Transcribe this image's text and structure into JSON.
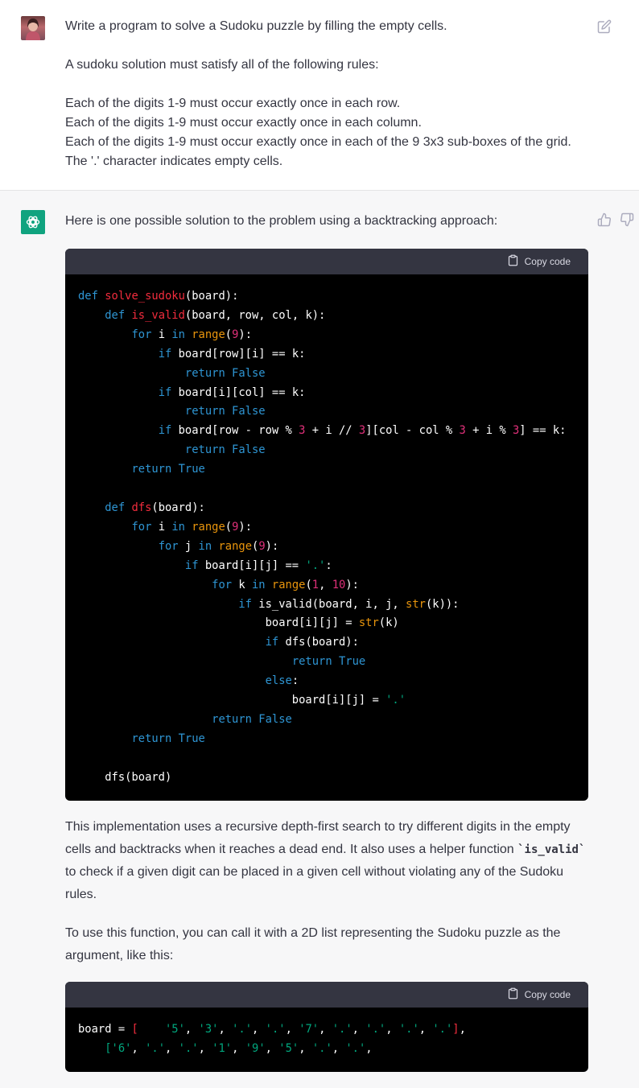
{
  "user": {
    "avatar": "user-avatar",
    "lines": [
      "Write a program to solve a Sudoku puzzle by filling the empty cells.",
      "A sudoku solution must satisfy all of the following rules:",
      "Each of the digits 1-9 must occur exactly once in each row.",
      "Each of the digits 1-9 must occur exactly once in each column.",
      "Each of the digits 1-9 must occur exactly once in each of the 9 3x3 sub-boxes of the grid.",
      "The '.' character indicates empty cells."
    ]
  },
  "assistant": {
    "intro": "Here is one possible solution to the problem using a backtracking approach:",
    "copy_label": "Copy code",
    "code1": [
      [
        [
          "kw",
          "def "
        ],
        [
          "fn",
          "solve_sudoku"
        ],
        [
          "nm",
          "(board):"
        ]
      ],
      [
        [
          "nm",
          "    "
        ],
        [
          "kw",
          "def "
        ],
        [
          "fn",
          "is_valid"
        ],
        [
          "nm",
          "(board, row, col, k):"
        ]
      ],
      [
        [
          "nm",
          "        "
        ],
        [
          "kw",
          "for "
        ],
        [
          "nm",
          "i "
        ],
        [
          "kw",
          "in "
        ],
        [
          "bi",
          "range"
        ],
        [
          "nm",
          "("
        ],
        [
          "num",
          "9"
        ],
        [
          "nm",
          "):"
        ]
      ],
      [
        [
          "nm",
          "            "
        ],
        [
          "kw",
          "if "
        ],
        [
          "nm",
          "board[row][i] == k:"
        ]
      ],
      [
        [
          "nm",
          "                "
        ],
        [
          "kw",
          "return False"
        ]
      ],
      [
        [
          "nm",
          "            "
        ],
        [
          "kw",
          "if "
        ],
        [
          "nm",
          "board[i][col] == k:"
        ]
      ],
      [
        [
          "nm",
          "                "
        ],
        [
          "kw",
          "return False"
        ]
      ],
      [
        [
          "nm",
          "            "
        ],
        [
          "kw",
          "if "
        ],
        [
          "nm",
          "board[row - row % "
        ],
        [
          "num",
          "3"
        ],
        [
          "nm",
          " + i // "
        ],
        [
          "num",
          "3"
        ],
        [
          "nm",
          "][col - col % "
        ],
        [
          "num",
          "3"
        ],
        [
          "nm",
          " + i % "
        ],
        [
          "num",
          "3"
        ],
        [
          "nm",
          "] == k:"
        ]
      ],
      [
        [
          "nm",
          "                "
        ],
        [
          "kw",
          "return False"
        ]
      ],
      [
        [
          "nm",
          "        "
        ],
        [
          "kw",
          "return True"
        ]
      ],
      [
        [
          "nm",
          ""
        ]
      ],
      [
        [
          "nm",
          "    "
        ],
        [
          "kw",
          "def "
        ],
        [
          "fn",
          "dfs"
        ],
        [
          "nm",
          "(board):"
        ]
      ],
      [
        [
          "nm",
          "        "
        ],
        [
          "kw",
          "for "
        ],
        [
          "nm",
          "i "
        ],
        [
          "kw",
          "in "
        ],
        [
          "bi",
          "range"
        ],
        [
          "nm",
          "("
        ],
        [
          "num",
          "9"
        ],
        [
          "nm",
          "):"
        ]
      ],
      [
        [
          "nm",
          "            "
        ],
        [
          "kw",
          "for "
        ],
        [
          "nm",
          "j "
        ],
        [
          "kw",
          "in "
        ],
        [
          "bi",
          "range"
        ],
        [
          "nm",
          "("
        ],
        [
          "num",
          "9"
        ],
        [
          "nm",
          "):"
        ]
      ],
      [
        [
          "nm",
          "                "
        ],
        [
          "kw",
          "if "
        ],
        [
          "nm",
          "board[i][j] == "
        ],
        [
          "str",
          "'.'"
        ],
        [
          "nm",
          ":"
        ]
      ],
      [
        [
          "nm",
          "                    "
        ],
        [
          "kw",
          "for "
        ],
        [
          "nm",
          "k "
        ],
        [
          "kw",
          "in "
        ],
        [
          "bi",
          "range"
        ],
        [
          "nm",
          "("
        ],
        [
          "num",
          "1"
        ],
        [
          "nm",
          ", "
        ],
        [
          "num",
          "10"
        ],
        [
          "nm",
          "):"
        ]
      ],
      [
        [
          "nm",
          "                        "
        ],
        [
          "kw",
          "if "
        ],
        [
          "nm",
          "is_valid(board, i, j, "
        ],
        [
          "bi",
          "str"
        ],
        [
          "nm",
          "(k)):"
        ]
      ],
      [
        [
          "nm",
          "                            board[i][j] = "
        ],
        [
          "bi",
          "str"
        ],
        [
          "nm",
          "(k)"
        ]
      ],
      [
        [
          "nm",
          "                            "
        ],
        [
          "kw",
          "if "
        ],
        [
          "nm",
          "dfs(board):"
        ]
      ],
      [
        [
          "nm",
          "                                "
        ],
        [
          "kw",
          "return True"
        ]
      ],
      [
        [
          "nm",
          "                            "
        ],
        [
          "kw",
          "else"
        ],
        [
          "nm",
          ":"
        ]
      ],
      [
        [
          "nm",
          "                                board[i][j] = "
        ],
        [
          "str",
          "'.'"
        ]
      ],
      [
        [
          "nm",
          "                    "
        ],
        [
          "kw",
          "return False"
        ]
      ],
      [
        [
          "nm",
          "        "
        ],
        [
          "kw",
          "return True"
        ]
      ],
      [
        [
          "nm",
          ""
        ]
      ],
      [
        [
          "nm",
          "    dfs(board)"
        ]
      ]
    ],
    "explain_before": "This implementation uses a recursive depth-first search to try different digits in the empty cells and backtracks when it reaches a dead end. It also uses a helper function ",
    "explain_code": "`is_valid`",
    "explain_after": " to check if a given digit can be placed in a given cell without violating any of the Sudoku rules.",
    "usage": "To use this function, you can call it with a 2D list representing the Sudoku puzzle as the argument, like this:",
    "code2": [
      [
        [
          "nm",
          "board = "
        ],
        [
          "fn",
          "[    "
        ],
        [
          "str",
          "'5'"
        ],
        [
          "nm",
          ", "
        ],
        [
          "str",
          "'3'"
        ],
        [
          "nm",
          ", "
        ],
        [
          "str",
          "'.'"
        ],
        [
          "nm",
          ", "
        ],
        [
          "str",
          "'.'"
        ],
        [
          "nm",
          ", "
        ],
        [
          "str",
          "'7'"
        ],
        [
          "nm",
          ", "
        ],
        [
          "str",
          "'.'"
        ],
        [
          "nm",
          ", "
        ],
        [
          "str",
          "'.'"
        ],
        [
          "nm",
          ", "
        ],
        [
          "str",
          "'.'"
        ],
        [
          "nm",
          ", "
        ],
        [
          "str",
          "'.'"
        ],
        [
          "fn",
          "]"
        ],
        [
          "nm",
          ","
        ]
      ],
      [
        [
          "nm",
          "    "
        ],
        [
          "str",
          "['6'"
        ],
        [
          "nm",
          ", "
        ],
        [
          "str",
          "'.'"
        ],
        [
          "nm",
          ", "
        ],
        [
          "str",
          "'.'"
        ],
        [
          "nm",
          ", "
        ],
        [
          "str",
          "'1'"
        ],
        [
          "nm",
          ", "
        ],
        [
          "str",
          "'9'"
        ],
        [
          "nm",
          ", "
        ],
        [
          "str",
          "'5'"
        ],
        [
          "nm",
          ", "
        ],
        [
          "str",
          "'.'"
        ],
        [
          "nm",
          ", "
        ],
        [
          "str",
          "'.'"
        ],
        [
          "nm",
          ","
        ]
      ]
    ]
  },
  "icons": {
    "edit": "edit-icon",
    "thumbs_up": "thumbs-up-icon",
    "thumbs_down": "thumbs-down-icon",
    "clipboard": "clipboard-icon",
    "openai": "openai-logo-icon"
  },
  "colors": {
    "keyword": "#2e95d3",
    "function": "#f22c3d",
    "number": "#df3079",
    "builtin": "#e9950c",
    "string": "#00a67d",
    "accent": "#10a37f"
  }
}
